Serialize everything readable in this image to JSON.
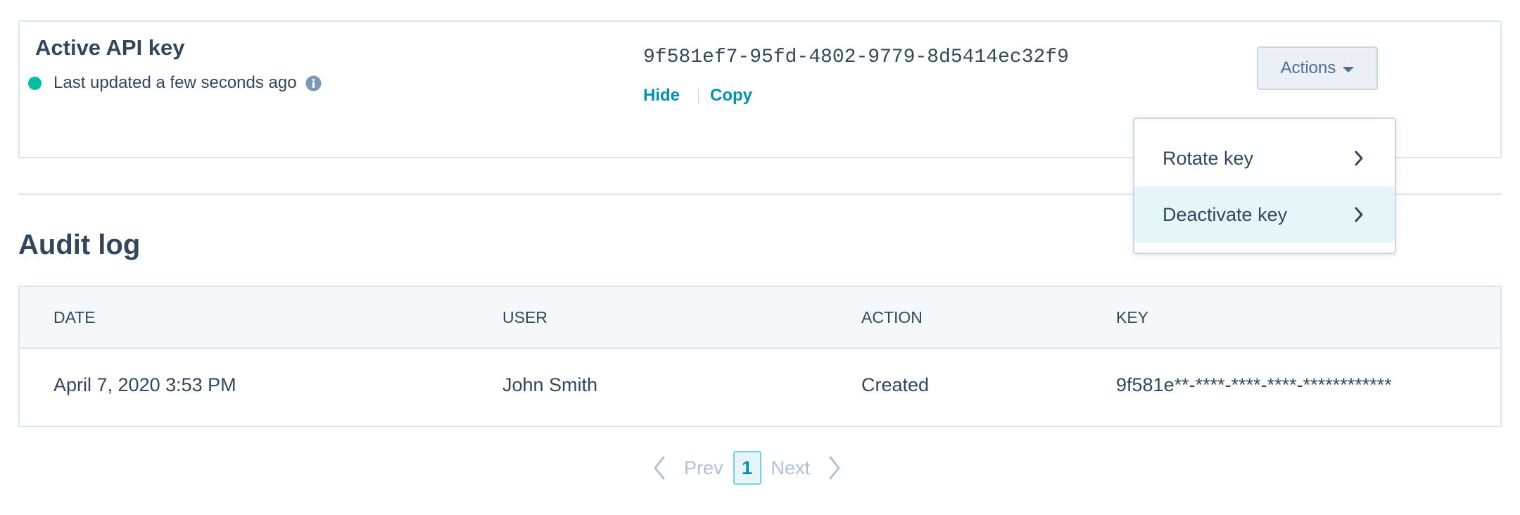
{
  "key_card": {
    "title": "Active API key",
    "status_text": "Last updated a few seconds ago",
    "status_color": "#00bda5",
    "key_value": "9f581ef7-95fd-4802-9779-8d5414ec32f9",
    "hide_label": "Hide",
    "copy_label": "Copy",
    "actions_label": "Actions"
  },
  "dropdown": {
    "items": [
      {
        "label": "Rotate key",
        "icon": "chevron-right-icon"
      },
      {
        "label": "Deactivate key",
        "icon": "chevron-right-icon",
        "highlighted": true
      }
    ]
  },
  "audit_log": {
    "title": "Audit log",
    "columns": [
      "DATE",
      "USER",
      "ACTION",
      "KEY"
    ],
    "rows": [
      {
        "date": "April 7, 2020 3:53 PM",
        "user": "John Smith",
        "action": "Created",
        "key": "9f581e**-****-****-****-************"
      }
    ]
  },
  "pagination": {
    "prev_label": "Prev",
    "current_page": "1",
    "next_label": "Next"
  },
  "colors": {
    "accent_link": "#0091ae",
    "text": "#33475b",
    "border": "#dfe3eb",
    "highlight": "#e5f5f8"
  }
}
